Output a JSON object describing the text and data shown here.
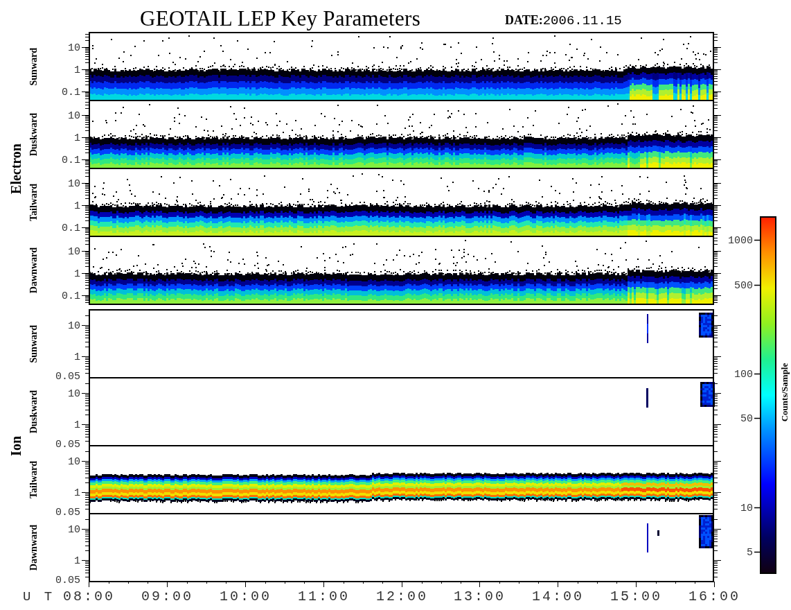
{
  "title": "GEOTAIL LEP Key Parameters",
  "date": {
    "label": "DATE:",
    "value": "2006.11.15"
  },
  "groups": [
    {
      "kind": "electron",
      "label": "Electron",
      "panels": [
        {
          "label": "Sunward",
          "yticks": [
            "10",
            "1",
            "0.1"
          ]
        },
        {
          "label": "Duskward",
          "yticks": [
            "10",
            "1",
            "0.1"
          ]
        },
        {
          "label": "Tailward",
          "yticks": [
            "10",
            "1",
            "0.1"
          ]
        },
        {
          "label": "Dawnward",
          "yticks": [
            "10",
            "1",
            "0.1"
          ]
        }
      ]
    },
    {
      "kind": "ion",
      "label": "Ion",
      "panels": [
        {
          "label": "Sunward",
          "yticks": [
            "10",
            "1",
            "0.05"
          ]
        },
        {
          "label": "Duskward",
          "yticks": [
            "10",
            "1",
            "0.05"
          ]
        },
        {
          "label": "Tailward",
          "yticks": [
            "10",
            "1",
            "0.05"
          ]
        },
        {
          "label": "Dawnward",
          "yticks": [
            "10",
            "1",
            "0.05"
          ]
        }
      ]
    }
  ],
  "x_axis": {
    "label": "U T",
    "ticks": [
      "08:00",
      "09:00",
      "10:00",
      "11:00",
      "12:00",
      "13:00",
      "14:00",
      "15:00",
      "16:00"
    ]
  },
  "colorbar": {
    "label": "Counts/Sample",
    "ticks": [
      "1000",
      "500",
      "100",
      "50",
      "10",
      "5"
    ]
  }
}
